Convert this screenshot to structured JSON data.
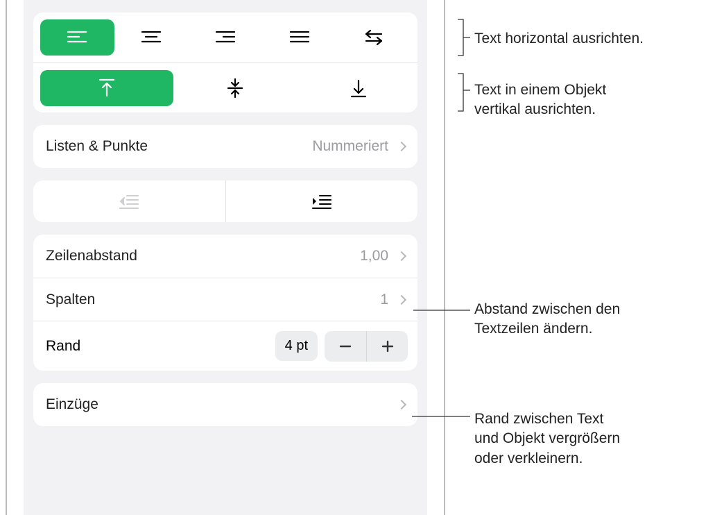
{
  "callouts": {
    "halign": "Text horizontal ausrichten.",
    "valign_l1": "Text in einem Objekt",
    "valign_l2": "vertikal ausrichten.",
    "linespace_l1": "Abstand zwischen den",
    "linespace_l2": "Textzeilen ändern.",
    "margin_l1": "Rand zwischen Text",
    "margin_l2": "und Objekt vergrößern",
    "margin_l3": "oder verkleinern."
  },
  "lists": {
    "label": "Listen & Punkte",
    "value": "Nummeriert"
  },
  "linespacing": {
    "label": "Zeilenabstand",
    "value": "1,00"
  },
  "columns": {
    "label": "Spalten",
    "value": "1"
  },
  "margin": {
    "label": "Rand",
    "value": "4 pt"
  },
  "indents": {
    "label": "Einzüge"
  }
}
